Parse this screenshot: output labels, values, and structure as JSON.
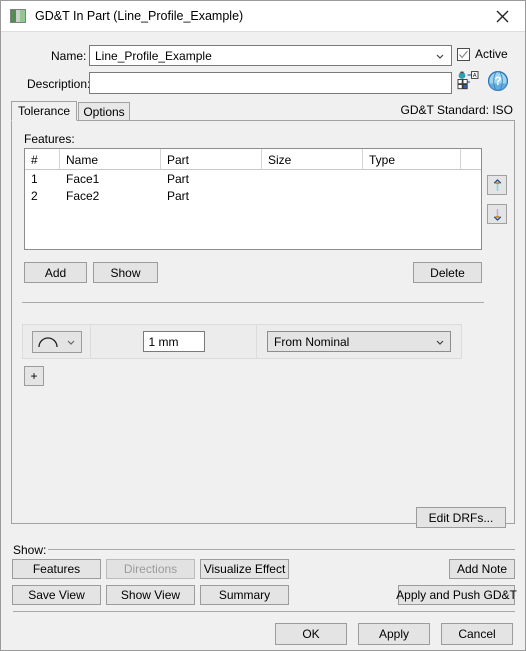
{
  "window": {
    "title": "GD&T In Part (Line_Profile_Example)",
    "icon": "window-app-icon",
    "close_icon": "close-icon"
  },
  "form": {
    "name_label": "Name:",
    "name_value": "Line_Profile_Example",
    "active_label": "Active",
    "active_checked": true,
    "description_label": "Description:",
    "description_value": "",
    "attribute_icon": "assign-attribute-icon",
    "help_icon": "help-globe-icon"
  },
  "tabs": {
    "items": [
      {
        "label": "Tolerance",
        "active": true
      },
      {
        "label": "Options",
        "active": false
      }
    ],
    "standard_text": "GD&T Standard: ISO"
  },
  "features": {
    "label": "Features:",
    "columns": [
      "#",
      "Name",
      "Part",
      "Size",
      "Type",
      ""
    ],
    "rows": [
      {
        "num": "1",
        "name": "Face1",
        "part": "Part",
        "size": "",
        "type": ""
      },
      {
        "num": "2",
        "name": "Face2",
        "part": "Part",
        "size": "",
        "type": ""
      }
    ],
    "move_up_icon": "arrow-up-icon",
    "move_down_icon": "arrow-down-icon",
    "add_label": "Add",
    "show_label": "Show",
    "delete_label": "Delete"
  },
  "tolerance": {
    "symbol_icon": "line-profile-arc-icon",
    "value": "1 mm",
    "mode": "From Nominal",
    "add_row_label": "+",
    "edit_drfs_label": "Edit DRFs..."
  },
  "show_group": {
    "label": "Show:",
    "buttons": [
      {
        "label": "Features",
        "disabled": false
      },
      {
        "label": "Directions",
        "disabled": true
      },
      {
        "label": "Visualize Effect",
        "disabled": false
      },
      {
        "label": "Add Note",
        "disabled": false
      },
      {
        "label": "Save View",
        "disabled": false
      },
      {
        "label": "Show View",
        "disabled": false
      },
      {
        "label": "Summary",
        "disabled": false
      },
      {
        "label": "Apply and Push GD&T",
        "disabled": false
      }
    ]
  },
  "dialog_buttons": {
    "ok": "OK",
    "apply": "Apply",
    "cancel": "Cancel"
  },
  "colors": {
    "dialog_bg": "#f0f0f0",
    "titlebar_bg": "#ffffff",
    "field_bg": "#ffffff",
    "button_bg": "#e4e4e4",
    "border": "#9c9c9c",
    "disabled_text": "#9b9b9b",
    "accent_icon": "#2a6fb5"
  }
}
